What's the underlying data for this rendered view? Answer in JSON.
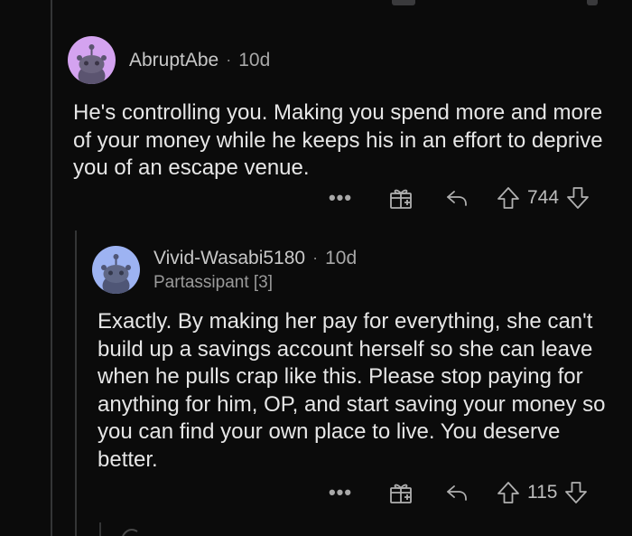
{
  "comments": [
    {
      "author": "AbruptAbe",
      "separator": "·",
      "time": "10d",
      "avatar_color": "#d4a3f0",
      "body": "He's controlling you. Making you spend more and more of your money while he keeps his in an effort to deprive you of an escape venue.",
      "more_label": "•••",
      "score": "744",
      "icons": [
        "award-icon",
        "reply-icon",
        "upvote-icon",
        "downvote-icon"
      ]
    },
    {
      "author": "Vivid-Wasabi5180",
      "separator": "·",
      "time": "10d",
      "flair": "Partassipant [3]",
      "avatar_color": "#9db3f2",
      "body": "Exactly.  By making her pay for everything, she can't build up a savings account herself so she can leave when he pulls crap like this.  Please stop paying for anything for him, OP, and start saving your money so you can find your own place to live.  You deserve better.",
      "more_label": "•••",
      "score": "115",
      "icons": [
        "award-icon",
        "reply-icon",
        "upvote-icon",
        "downvote-icon"
      ]
    }
  ],
  "colors": {
    "background": "#0b0b0b",
    "thread_line": "#343536",
    "text": "#e6e6e6",
    "meta": "#a8a8a8"
  }
}
